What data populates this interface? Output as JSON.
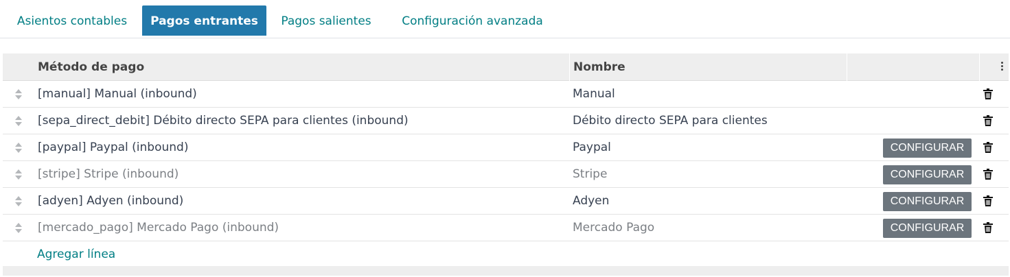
{
  "tabs": [
    {
      "label": "Asientos contables",
      "active": false
    },
    {
      "label": "Pagos entrantes",
      "active": true
    },
    {
      "label": "Pagos salientes",
      "active": false
    },
    {
      "label": "Configuración avanzada",
      "active": false
    }
  ],
  "table": {
    "columns": {
      "method": "Método de pago",
      "name": "Nombre"
    },
    "options_icon": "vertical-dots-icon",
    "rows": [
      {
        "method": "[manual] Manual (inbound)",
        "name": "Manual",
        "muted": false,
        "configure": false
      },
      {
        "method": "[sepa_direct_debit] Débito directo SEPA para clientes (inbound)",
        "name": "Débito directo SEPA para clientes",
        "muted": false,
        "configure": false
      },
      {
        "method": "[paypal] Paypal (inbound)",
        "name": "Paypal",
        "muted": false,
        "configure": true
      },
      {
        "method": "[stripe] Stripe (inbound)",
        "name": "Stripe",
        "muted": true,
        "configure": true
      },
      {
        "method": "[adyen] Adyen (inbound)",
        "name": "Adyen",
        "muted": false,
        "configure": true
      },
      {
        "method": "[mercado_pago] Mercado Pago (inbound)",
        "name": "Mercado Pago",
        "muted": true,
        "configure": true
      }
    ],
    "configure_label": "CONFIGURAR",
    "add_line_label": "Agregar línea"
  },
  "colors": {
    "accent": "#017e84",
    "active_tab": "#2279ab",
    "button": "#6c757d",
    "header_bg": "#eeeeee",
    "muted_text": "#7b7f84"
  }
}
